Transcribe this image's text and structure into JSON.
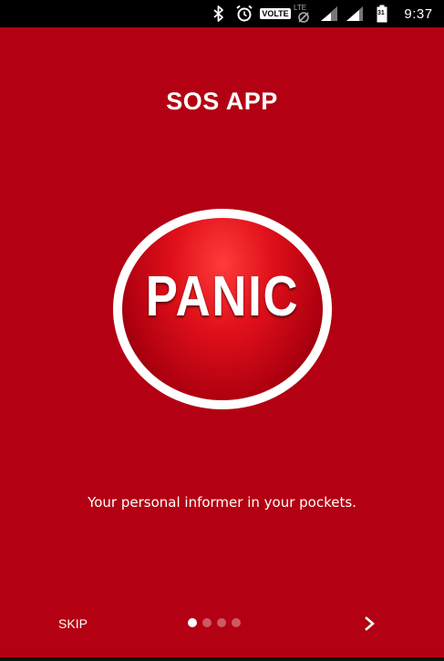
{
  "status_bar": {
    "volte_label": "VOLTE",
    "lte_label": "LTE",
    "battery_label": "31",
    "time": "9:37",
    "icons": [
      "bluetooth-icon",
      "alarm-icon",
      "volte-icon",
      "lte-data-icon",
      "signal-icon",
      "signal-icon",
      "battery-icon"
    ]
  },
  "header": {
    "title": "SOS APP"
  },
  "panic_graphic": {
    "label": "PANIC"
  },
  "description": {
    "text": "Your personal informer in your pockets."
  },
  "navigation": {
    "skip_label": "SKIP",
    "page_count": 4,
    "current_page": 1,
    "next_icon": "chevron-right-icon"
  },
  "colors": {
    "background": "#b30012",
    "status_bar": "#000000",
    "text": "#ffffff"
  }
}
